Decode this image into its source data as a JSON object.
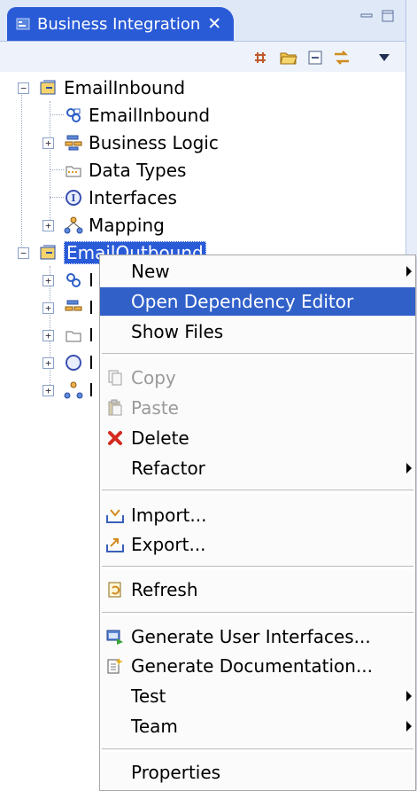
{
  "view": {
    "tab_title": "Business Integration",
    "tab_close": "✕"
  },
  "toolbar": {
    "buttons": [
      "link-icon",
      "open-folder-icon",
      "collapse-all-icon",
      "sync-icon",
      "view-menu-icon"
    ]
  },
  "tree": {
    "modules": [
      {
        "label": "EmailInbound",
        "expanded": true,
        "children": [
          "EmailInbound",
          "Business Logic",
          "Data Types",
          "Interfaces",
          "Mapping"
        ]
      },
      {
        "label": "EmailOutbound",
        "expanded": true,
        "selected": true,
        "children_partial": [
          "I",
          "I",
          "I",
          "I",
          "I"
        ]
      }
    ]
  },
  "menu": {
    "items": [
      {
        "label": "New",
        "submenu": true
      },
      {
        "label": "Open Dependency Editor",
        "highlighted": true
      },
      {
        "label": "Show Files"
      },
      {
        "label": "Copy",
        "disabled": true,
        "icon": "copy-icon"
      },
      {
        "label": "Paste",
        "disabled": true,
        "icon": "paste-icon"
      },
      {
        "label": "Delete",
        "icon": "delete-icon"
      },
      {
        "label": "Refactor",
        "submenu": true
      },
      {
        "label": "Import...",
        "icon": "import-icon"
      },
      {
        "label": "Export...",
        "icon": "export-icon"
      },
      {
        "label": "Refresh",
        "icon": "refresh-icon"
      },
      {
        "label": "Generate User Interfaces...",
        "icon": "generate-ui-icon"
      },
      {
        "label": "Generate Documentation...",
        "icon": "generate-doc-icon"
      },
      {
        "label": "Test",
        "submenu": true
      },
      {
        "label": "Team",
        "submenu": true
      },
      {
        "label": "Properties"
      }
    ]
  },
  "colors": {
    "selection": "#2a5bd7",
    "menu_highlight": "#3160c9",
    "tab_background": "#2a5bd7"
  }
}
